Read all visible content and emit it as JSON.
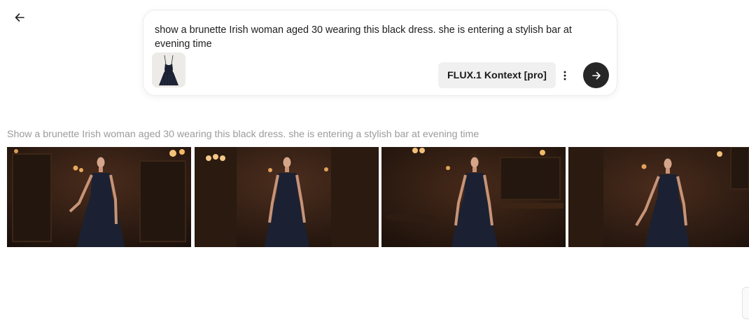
{
  "prompt": {
    "text": "show a brunette Irish woman aged 30 wearing this black dress. she is entering a stylish bar at evening time",
    "model_label": "FLUX.1 Kontext [pro]"
  },
  "result": {
    "caption": "Show a brunette Irish woman aged 30 wearing this black dress. she is entering a stylish bar at evening time",
    "image_count": 4
  },
  "icons": {
    "back": "arrow-left-icon",
    "more": "more-vertical-icon",
    "send": "arrow-right-icon"
  },
  "colors": {
    "send_button": "#262626",
    "chip_background": "#f0f0f0",
    "caption_text": "#9b9b9b"
  }
}
